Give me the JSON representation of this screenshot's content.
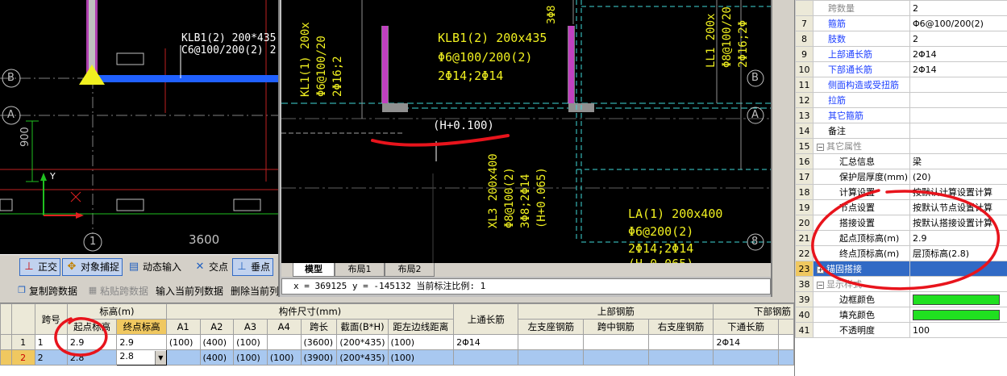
{
  "cad_left": {
    "beam_label_1": "KLB1(2) 200*435",
    "beam_label_2": "C6@100/200(2) 2",
    "axis_b": "B",
    "axis_a": "A",
    "axis_1": "1",
    "dim_900": "900",
    "dim_3600": "3600",
    "y_axis": "Y"
  },
  "viewer": {
    "beam_klb": "KLB1(2) 200x435",
    "beam_stirrup": "Φ6@100/200(2)",
    "beam_bars": "2Φ14;2Φ14",
    "elevation": "(H+0.100)",
    "kl_label": "KL1(1) 200x",
    "kl_sub": "Φ6@100/20",
    "kl_bars": "2Φ16;2",
    "ll_label": "LL1 200x",
    "ll_sub": "Φ8@100/20",
    "ll_bars": "2Φ16;2Φ",
    "xl3_label": "XL3 200x400",
    "xl3_sub": "Φ8@100(2)",
    "xl3_bars": "3Φ8;2Φ14",
    "xl3_elev": "(H+0.065)",
    "la_label": "LA(1) 200x400",
    "la_sub": "Φ6@200(2)",
    "la_bars": "2Φ14;2Φ14",
    "la_elev": "(H-0.065)",
    "top_frag": "3Φ8",
    "right_b": "B",
    "right_a": "A",
    "right_8": "8",
    "tabs": [
      "模型",
      "布局1",
      "布局2"
    ],
    "coord_text": "x = 369125 y = -145132 当前标注比例: 1"
  },
  "snap_toolbar": {
    "items": [
      "正交",
      "对象捕捉",
      "动态输入",
      "交点",
      "垂点"
    ]
  },
  "grid_toolbar": {
    "copy": "复制跨数据",
    "paste": "粘贴跨数据",
    "input_col": "输入当前列数据",
    "delete_col": "删除当前列"
  },
  "grid": {
    "group_headers": {
      "span": "跨号",
      "elevation": "标高(m)",
      "size": "构件尺寸(mm)",
      "top_through": "上通长筋",
      "top_rebar": "上部钢筋",
      "bottom_rebar": "下部钢筋"
    },
    "sub_headers": [
      "起点标高",
      "终点标高",
      "A1",
      "A2",
      "A3",
      "A4",
      "跨长",
      "截面(B*H)",
      "距左边线距离",
      "左支座钢筋",
      "跨中钢筋",
      "右支座钢筋",
      "下通长筋"
    ],
    "rows": [
      {
        "rn": "1",
        "span": "1",
        "start": "2.9",
        "end": "2.9",
        "a1": "(100)",
        "a2": "(400)",
        "a3": "(100)",
        "a4": "",
        "len": "(3600)",
        "sec": "(200*435)",
        "dist": "(100)",
        "top": "2Φ14",
        "left": "",
        "mid": "",
        "right": "",
        "bot": "2Φ14"
      },
      {
        "rn": "2",
        "span": "2",
        "start": "2.8",
        "end": "2.8",
        "a1": "",
        "a2": "(400)",
        "a3": "(100)",
        "a4": "(100)",
        "len": "(3900)",
        "sec": "(200*435)",
        "dist": "(100)",
        "top": "",
        "left": "",
        "mid": "",
        "right": "",
        "bot": ""
      }
    ]
  },
  "props": {
    "rows": [
      {
        "n": "",
        "name": "跨数量",
        "val": "2",
        "cls": "grey",
        "indent": 1
      },
      {
        "n": "7",
        "name": "箍筋",
        "val": "Φ6@100/200(2)",
        "cls": "blue",
        "indent": 1
      },
      {
        "n": "8",
        "name": "肢数",
        "val": "2",
        "cls": "blue",
        "indent": 1
      },
      {
        "n": "9",
        "name": "上部通长筋",
        "val": "2Φ14",
        "cls": "blue",
        "indent": 1
      },
      {
        "n": "10",
        "name": "下部通长筋",
        "val": "2Φ14",
        "cls": "blue",
        "indent": 1
      },
      {
        "n": "11",
        "name": "侧面构造或受扭筋",
        "val": "",
        "cls": "blue",
        "indent": 1
      },
      {
        "n": "12",
        "name": "拉筋",
        "val": "",
        "cls": "blue",
        "indent": 1
      },
      {
        "n": "13",
        "name": "其它箍筋",
        "val": "",
        "cls": "blue",
        "indent": 1
      },
      {
        "n": "14",
        "name": "备注",
        "val": "",
        "cls": "",
        "indent": 1
      },
      {
        "n": "15",
        "name": "其它属性",
        "val": "",
        "cls": "grey",
        "indent": 0,
        "tree": "−"
      },
      {
        "n": "16",
        "name": "汇总信息",
        "val": "梁",
        "cls": "",
        "indent": 2
      },
      {
        "n": "17",
        "name": "保护层厚度(mm)",
        "val": "(20)",
        "cls": "",
        "indent": 2
      },
      {
        "n": "18",
        "name": "计算设置",
        "val": "按默认计算设置计算",
        "cls": "",
        "indent": 2
      },
      {
        "n": "19",
        "name": "节点设置",
        "val": "按默认节点设置计算",
        "cls": "",
        "indent": 2
      },
      {
        "n": "20",
        "name": "搭接设置",
        "val": "按默认搭接设置计算",
        "cls": "",
        "indent": 2
      },
      {
        "n": "21",
        "name": "起点顶标高(m)",
        "val": "2.9",
        "cls": "",
        "indent": 2
      },
      {
        "n": "22",
        "name": "终点顶标高(m)",
        "val": "层顶标高(2.8)",
        "cls": "",
        "indent": 2
      },
      {
        "n": "23",
        "name": "锚固搭接",
        "val": "",
        "cls": "",
        "indent": 0,
        "tree": "+",
        "sel": true
      },
      {
        "n": "38",
        "name": "显示样式",
        "val": "",
        "cls": "grey",
        "indent": 0,
        "tree": "−"
      },
      {
        "n": "39",
        "name": "边框颜色",
        "val": "",
        "cls": "",
        "indent": 2,
        "swatch": true
      },
      {
        "n": "40",
        "name": "填充颜色",
        "val": "",
        "cls": "",
        "indent": 2,
        "swatch": true
      },
      {
        "n": "41",
        "name": "不透明度",
        "val": "100",
        "cls": "",
        "indent": 2
      }
    ]
  },
  "colors": {
    "annotation_red": "#e8141c",
    "cad_yellow": "#f0f020",
    "cad_cyan": "#40d8d8",
    "cad_magenta": "#c040c0",
    "fill_green": "#20e020"
  }
}
